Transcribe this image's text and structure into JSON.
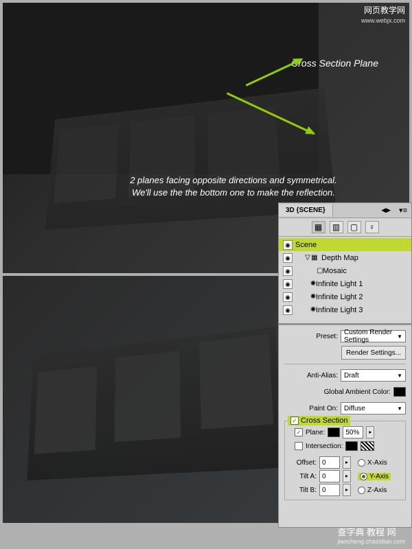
{
  "watermark_top": {
    "text": "网页教学网",
    "url": "www.webjx.com"
  },
  "watermark_bottom": {
    "text": "查字典 教程 网",
    "url": "jiaocheng.chazidian.com"
  },
  "annotations": {
    "cross_section": "Cross Section Plane",
    "caption_line1": "2 planes facing opposite directions and symmetrical.",
    "caption_line2": "We'll use the the bottom one to make the reflection."
  },
  "panel": {
    "title": "3D {SCENE}",
    "tree": {
      "scene": "Scene",
      "depth_map": "Depth Map",
      "mosaic": "Mosaic",
      "light1": "Infinite Light 1",
      "light2": "Infinite Light 2",
      "light3": "Infinite Light 3"
    },
    "preset_label": "Preset:",
    "preset_value": "Custom Render Settings",
    "render_settings_btn": "Render Settings...",
    "anti_alias_label": "Anti-Alias:",
    "anti_alias_value": "Draft",
    "global_ambient_label": "Global Ambient Color:",
    "paint_on_label": "Paint On:",
    "paint_on_value": "Diffuse",
    "cross_section_label": "Cross Section",
    "plane_label": "Plane:",
    "plane_opacity": "50%",
    "intersection_label": "Intersection:",
    "offset_label": "Offset:",
    "offset_value": "0",
    "tilt_a_label": "Tilt A:",
    "tilt_a_value": "0",
    "tilt_b_label": "Tilt B:",
    "tilt_b_value": "0",
    "x_axis": "X-Axis",
    "y_axis": "Y-Axis",
    "z_axis": "Z-Axis"
  }
}
